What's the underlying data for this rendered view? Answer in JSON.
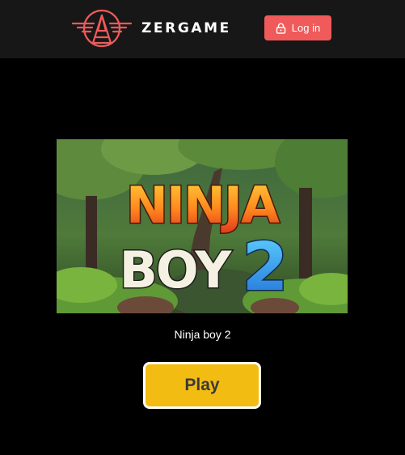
{
  "header": {
    "brand_name": "ZERGAME",
    "logo_icon": "winged-triangle-logo",
    "login_icon": "lock-icon",
    "login_label": "Log in",
    "accent_color": "#f05a5a",
    "background_color": "#171717"
  },
  "game": {
    "thumbnail_logo_line1": "NINJA",
    "thumbnail_logo_line2": "BOY",
    "thumbnail_logo_number": "2",
    "title": "Ninja boy 2",
    "play_label": "Play",
    "play_color": "#f3bc12"
  }
}
